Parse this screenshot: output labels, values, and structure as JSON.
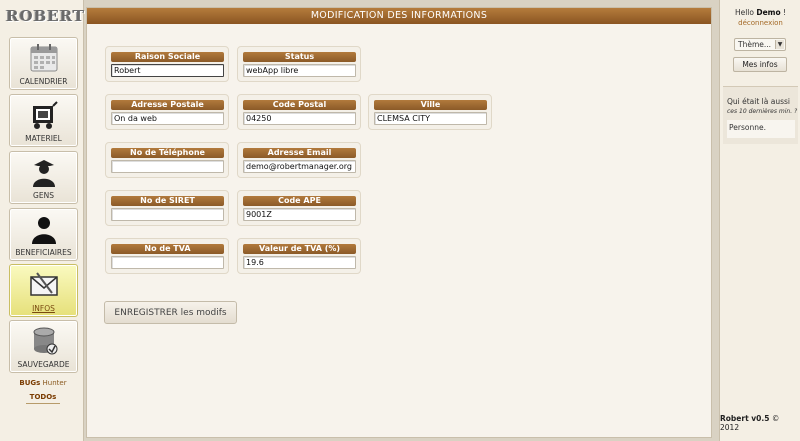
{
  "app": {
    "logo_text": "ROBERT",
    "version_name": "Robert v0.5",
    "copyright": "© 2012"
  },
  "sidebar": {
    "items": [
      {
        "label": "CALENDRIER",
        "icon": "calendar-icon"
      },
      {
        "label": "MATERIEL",
        "icon": "equipment-cart-icon"
      },
      {
        "label": "GENS",
        "icon": "people-icon"
      },
      {
        "label": "BENEFICIAIRES",
        "icon": "person-silhouette-icon"
      },
      {
        "label": "INFOS",
        "icon": "envelope-icon",
        "active": true
      },
      {
        "label": "SAUVEGARDE",
        "icon": "database-icon"
      }
    ],
    "bugs_bold": "BUGs",
    "bugs_rest": " Hunter",
    "todos": "TODOs"
  },
  "main": {
    "title": "MODIFICATION DES INFORMATIONS",
    "fields": {
      "raison_sociale": {
        "label": "Raison Sociale",
        "value": "Robert"
      },
      "status": {
        "label": "Status",
        "value": "webApp libre"
      },
      "adresse_postale": {
        "label": "Adresse Postale",
        "value": "On da web"
      },
      "code_postal": {
        "label": "Code Postal",
        "value": "04250"
      },
      "ville": {
        "label": "Ville",
        "value": "CLEMSA CITY"
      },
      "telephone": {
        "label": "No de Téléphone",
        "value": ""
      },
      "email": {
        "label": "Adresse Email",
        "value": "demo@robertmanager.org"
      },
      "siret": {
        "label": "No de SIRET",
        "value": ""
      },
      "code_ape": {
        "label": "Code APE",
        "value": "9001Z"
      },
      "tva": {
        "label": "No de TVA",
        "value": ""
      },
      "valeur_tva": {
        "label": "Valeur de TVA (%)",
        "value": "19.6"
      }
    },
    "save_label": "ENREGISTRER les modifs"
  },
  "user_panel": {
    "hello": "Hello ",
    "username": "Demo",
    "exclaim": " !",
    "logout": "déconnexion",
    "theme_selected": "Thème...",
    "my_infos": "Mes infos",
    "who_was_title": "Qui était là aussi",
    "who_was_sub": "ces 10 dernières min. ?",
    "who_was_list": "Personne."
  },
  "colors": {
    "accent_brown": "#8a5522",
    "active_nav": "#e6e07a",
    "background": "#d9d2c3"
  }
}
